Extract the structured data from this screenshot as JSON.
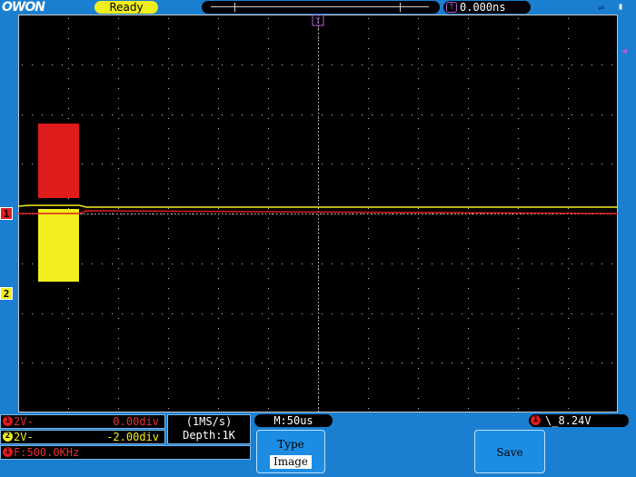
{
  "header": {
    "logo": "OWON",
    "status": "Ready",
    "trigger_time": "0.000ns",
    "usb_icon": "usb-icon",
    "battery_icon": "battery-icon"
  },
  "channels": {
    "ch1": {
      "id": "1",
      "volts_div": "2V-",
      "offset": "0.00div",
      "color": "#e01b1b"
    },
    "ch2": {
      "id": "2",
      "volts_div": "2V-",
      "offset": "-2.00div",
      "color": "#f2ee1e"
    }
  },
  "measurement": {
    "channel": "1",
    "text": "F:500.0KHz"
  },
  "acquisition": {
    "rate": "(1MS/s)",
    "depth": "Depth:1K"
  },
  "timebase": "M:50us",
  "trigger": {
    "channel": "1",
    "text": "\\_8.24V"
  },
  "menu": {
    "type_label": "Type",
    "type_value": "Image",
    "save_label": "Save"
  },
  "colors": {
    "background": "#1a7fd0",
    "grid": "#c8c8c8",
    "ch1": "#e01b1b",
    "ch2": "#f2ee1e",
    "trigger": "#b45cd6"
  }
}
